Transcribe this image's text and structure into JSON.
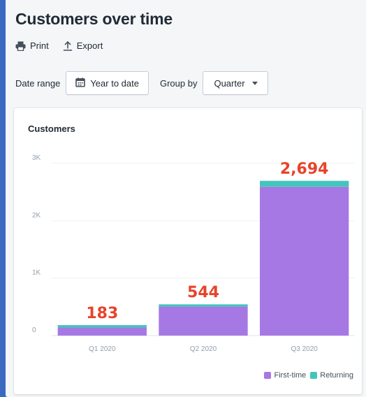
{
  "page": {
    "title": "Customers over time"
  },
  "actions": {
    "print_label": "Print",
    "export_label": "Export"
  },
  "filters": {
    "date_range_label": "Date range",
    "date_range_value": "Year to date",
    "group_by_label": "Group by",
    "group_by_value": "Quarter"
  },
  "colors": {
    "first_time": "#a678e4",
    "returning": "#45c4bc",
    "annotation": "#e8432a"
  },
  "chart_data": {
    "type": "bar",
    "stacked": true,
    "title": "Customers",
    "categories": [
      "Q1 2020",
      "Q2 2020",
      "Q3 2020"
    ],
    "series": [
      {
        "name": "First-time",
        "values": [
          140,
          505,
          2590
        ],
        "color": "#a678e4"
      },
      {
        "name": "Returning",
        "values": [
          43,
          39,
          104
        ],
        "color": "#45c4bc"
      }
    ],
    "totals_annotations": [
      "183",
      "544",
      "2,694"
    ],
    "ylim": [
      0,
      3000
    ],
    "yticks": [
      0,
      1000,
      2000,
      3000
    ],
    "ytick_labels": [
      "0",
      "1K",
      "2K",
      "3K"
    ],
    "grid": true,
    "legend_position": "bottom-right"
  }
}
